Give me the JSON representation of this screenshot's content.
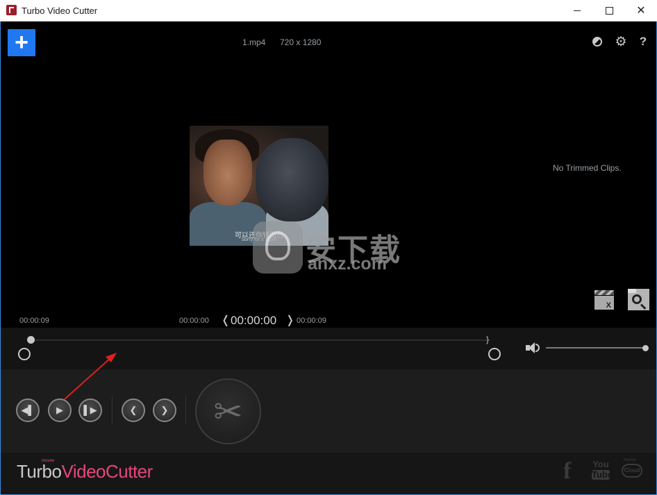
{
  "window": {
    "title": "Turbo Video Cutter",
    "minimize_icon": "minimize-icon",
    "maximize_icon": "maximize-icon",
    "close_icon": "close-icon"
  },
  "toolbar": {
    "add_label": "+",
    "file_name": "1.mp4",
    "resolution": "720 x 1280",
    "icons": [
      "contrast-icon",
      "gear-icon",
      "help-icon"
    ],
    "help_label": "?"
  },
  "preview": {
    "subtitle": "可以还你钱而已",
    "subtitle_en": "Sorry for it again"
  },
  "watermark": {
    "text": "安下载",
    "sub": "anxz.com"
  },
  "clips": {
    "empty_message": "No Trimmed Clips.",
    "icons": [
      "clear-clips-icon",
      "preview-clips-icon"
    ],
    "clear_mark": "X"
  },
  "time": {
    "left": "00:00:09",
    "trim_start": "00:00:00",
    "current": "00:00:00",
    "trim_end": "00:00:09",
    "bracket_left": "❬",
    "bracket_right": "❭"
  },
  "timeline": {
    "progress": 0,
    "volume": 1.0,
    "end_mark": "}"
  },
  "controls": {
    "prev_frame": "◀▌",
    "play": "▶",
    "next_frame": "▌▶",
    "prev_mark": "❮",
    "next_mark": "❯",
    "cut": "✂"
  },
  "brand": {
    "turbo": "Turbo",
    "video_cutter": "VideoCutter",
    "maker": "muvee"
  },
  "social": {
    "facebook": "f",
    "youtube_you": "You",
    "youtube_tube": "Tube",
    "cloud_top": "muvee",
    "cloud": "Cloud"
  },
  "colors": {
    "accent": "#1f78f0",
    "brand_pink": "#e8467c",
    "annotation_arrow": "#e02020"
  }
}
